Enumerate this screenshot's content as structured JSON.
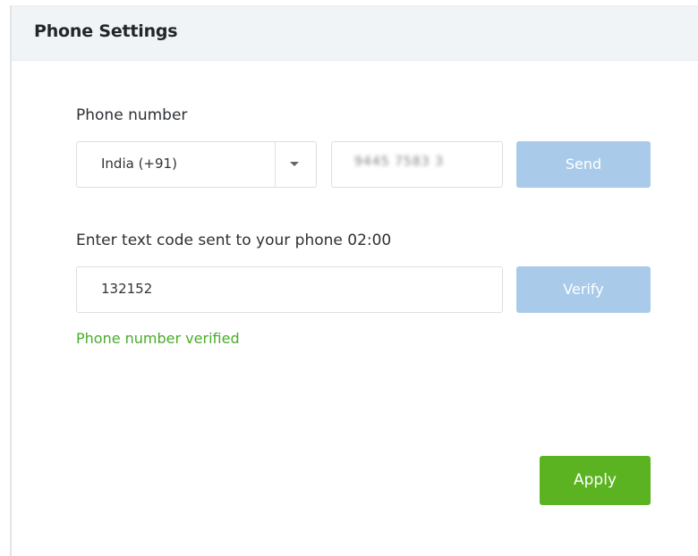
{
  "header": {
    "title": "Phone Settings"
  },
  "phone": {
    "label": "Phone number",
    "country_selected": "India (+91)",
    "number_value": "9445 7583 3",
    "send_label": "Send"
  },
  "code": {
    "label": "Enter text code sent to your phone 02:00",
    "value": "132152",
    "verify_label": "Verify",
    "status_message": "Phone number verified"
  },
  "actions": {
    "apply_label": "Apply"
  },
  "colors": {
    "disabled_button": "#a9cbe9",
    "apply_button": "#5bb321",
    "success_text": "#4aab2b",
    "header_bg": "#f1f4f7"
  }
}
